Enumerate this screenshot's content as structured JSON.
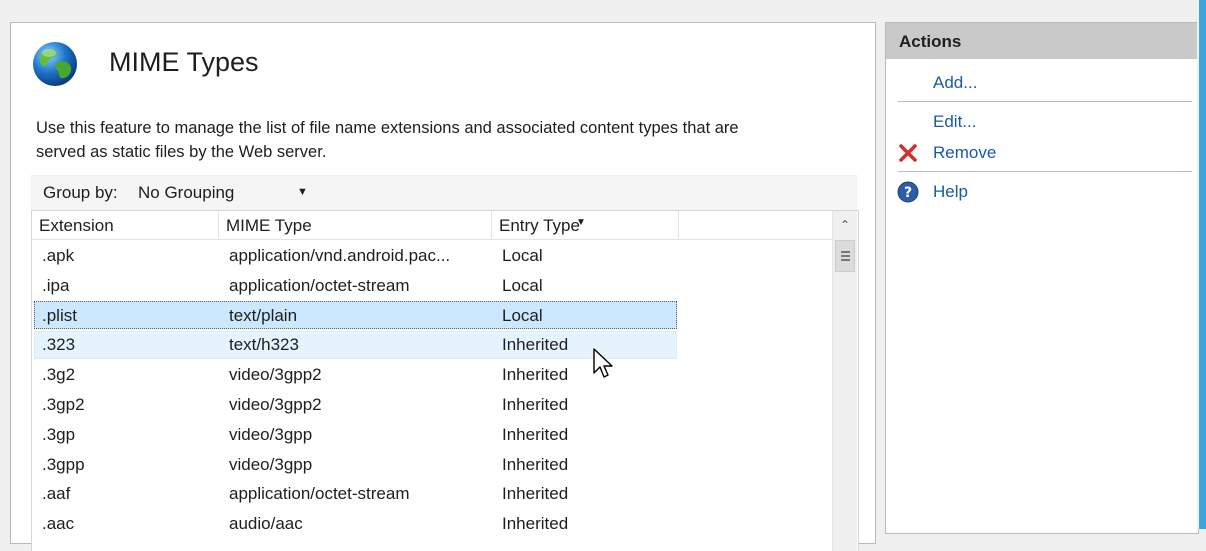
{
  "feature": {
    "title": "MIME Types",
    "description_line1": "Use this feature to manage the list of file name extensions and associated content types that are",
    "description_line2": "served as static files by the Web server.",
    "icon": "globe-icon"
  },
  "group_by": {
    "label": "Group by:",
    "value": "No Grouping"
  },
  "table": {
    "columns": [
      "Extension",
      "MIME Type",
      "Entry Type"
    ],
    "sorted_column": "Entry Type",
    "rows": [
      {
        "extension": ".apk",
        "mime": "application/vnd.android.pac...",
        "entry": "Local"
      },
      {
        "extension": ".ipa",
        "mime": "application/octet-stream",
        "entry": "Local"
      },
      {
        "extension": ".plist",
        "mime": "text/plain",
        "entry": "Local",
        "state": "selected"
      },
      {
        "extension": ".323",
        "mime": "text/h323",
        "entry": "Inherited",
        "state": "hovered"
      },
      {
        "extension": ".3g2",
        "mime": "video/3gpp2",
        "entry": "Inherited"
      },
      {
        "extension": ".3gp2",
        "mime": "video/3gpp2",
        "entry": "Inherited"
      },
      {
        "extension": ".3gp",
        "mime": "video/3gpp",
        "entry": "Inherited"
      },
      {
        "extension": ".3gpp",
        "mime": "video/3gpp",
        "entry": "Inherited"
      },
      {
        "extension": ".aaf",
        "mime": "application/octet-stream",
        "entry": "Inherited"
      },
      {
        "extension": ".aac",
        "mime": "audio/aac",
        "entry": "Inherited"
      }
    ]
  },
  "actions": {
    "header": "Actions",
    "add": "Add...",
    "edit": "Edit...",
    "remove": "Remove",
    "help": "Help"
  },
  "colors": {
    "link": "#1c5aa6",
    "selected_row": "#cce8ff",
    "hover_row": "#e5f3ff",
    "actions_header": "#c9c9c9",
    "remove_icon": "#d32f2f",
    "help_icon": "#2e5da8"
  }
}
